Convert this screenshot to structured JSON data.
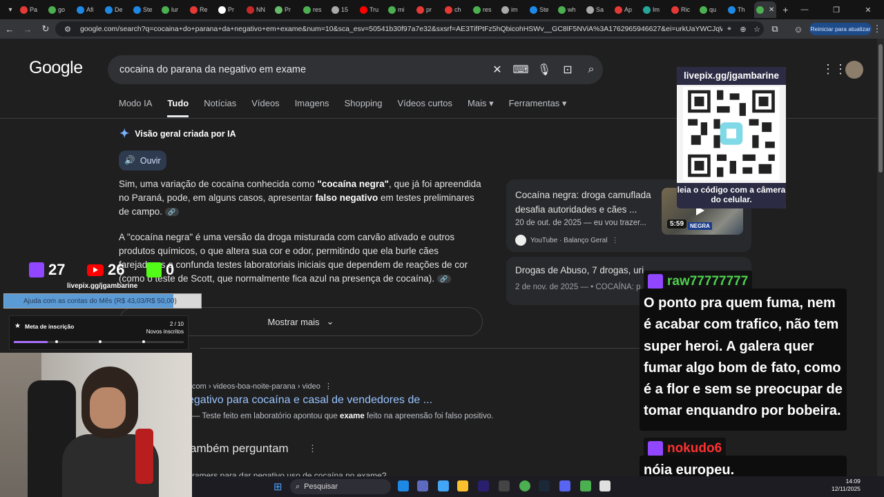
{
  "browser": {
    "tabs": [
      {
        "label": "Pa",
        "color": "#e53935"
      },
      {
        "label": "go",
        "color": "#4caf50"
      },
      {
        "label": "Afi",
        "color": "#1e88e5"
      },
      {
        "label": "De",
        "color": "#1e88e5"
      },
      {
        "label": "Ste",
        "color": "#1e88e5"
      },
      {
        "label": "lur",
        "color": "#4caf50"
      },
      {
        "label": "Re",
        "color": "#e53935"
      },
      {
        "label": "Pr",
        "color": "#ffffff"
      },
      {
        "label": "NN",
        "color": "#c62828"
      },
      {
        "label": "Pr",
        "color": "#66bb6a"
      },
      {
        "label": "res",
        "color": "#4caf50"
      },
      {
        "label": "15",
        "color": "#aaaaaa"
      },
      {
        "label": "Tru",
        "color": "#ff0000"
      },
      {
        "label": "mi",
        "color": "#4caf50"
      },
      {
        "label": "pr",
        "color": "#e53935"
      },
      {
        "label": "ch",
        "color": "#e53935"
      },
      {
        "label": "res",
        "color": "#4caf50"
      },
      {
        "label": "im",
        "color": "#aaaaaa"
      },
      {
        "label": "Ste",
        "color": "#1e88e5"
      },
      {
        "label": "wh",
        "color": "#4caf50"
      },
      {
        "label": "Sa",
        "color": "#aaaaaa"
      },
      {
        "label": "Ap",
        "color": "#e53935"
      },
      {
        "label": "Im",
        "color": "#26a69a"
      },
      {
        "label": "Ric",
        "color": "#e53935"
      },
      {
        "label": "qu",
        "color": "#4caf50"
      },
      {
        "label": "Th",
        "color": "#1e88e5"
      }
    ],
    "active_tab_color": "#4caf50",
    "url": "google.com/search?q=cocaina+do+parana+da+negativo+em+exame&num=10&sca_esv=50541b30f97a7e32&sxsrf=AE3TifPtFz5hQbicohHSWv__GC8lF5NViA%3A1762965946627&ei=urkUaYWCJqWChuMP_u7t2AU&oq=c...",
    "update_button": "Reiniciar para atualizar"
  },
  "search": {
    "logo": "Google",
    "query": "cocaina do parana da negativo em exame",
    "tabs": [
      "Modo IA",
      "Tudo",
      "Notícias",
      "Vídeos",
      "Imagens",
      "Shopping",
      "Vídeos curtos",
      "Mais",
      "Ferramentas"
    ]
  },
  "ai_overview": {
    "heading": "Visão geral criada por IA",
    "listen": "Ouvir",
    "show_more": "Mostrar mais"
  },
  "video_card": {
    "title": "Cocaína negra: droga camuflada desafia autoridades e cães ...",
    "date": "20 de out. de 2025 — eu vou trazer...",
    "source": "YouTube · Balanço Geral",
    "duration": "5:59",
    "thumb_label": "NEGRA"
  },
  "card2": {
    "title": "Drogas de Abuso, 7 drogas, uri...",
    "date": "2 de nov. de 2025 — • COCAÍNA: p..."
  },
  "result": {
    "cite": "com › videos-boa-noite-parana › video",
    "title": "egativo para cocaína e casal de vendedores de ...",
    "snippet_pre": "— Teste feito em laboratório apontou que ",
    "snippet_bold": "exame",
    "snippet_post": " feito na apreensão foi falso positivo.",
    "paa": "ambém perguntam",
    "paa_q": "ramers para dar negativo uso de cocaína no exame?"
  },
  "overlay": {
    "qr_url": "livepix.gg/jgambarine",
    "qr_caption": "leia o código com a câmera do celular.",
    "twitch_count": "27",
    "youtube_count": "26",
    "kick_count": "0",
    "livepix": "livepix.gg/jgambarine",
    "goal_text": "Ajuda com as contas do Mês (R$ 43,03/R$ 50,00)",
    "goal_progress": 0.86,
    "sub_title": "Meta de inscrição",
    "sub_count": "2 / 10",
    "sub_label": "Novos inscritos",
    "sub_progress": 0.2
  },
  "chat": [
    {
      "user": "raw77777777",
      "user_color": "#4fd14f",
      "message": "O ponto pra quem fuma, nem é acabar com trafico, não tem super heroi. A galera quer fumar algo bom de fato, como é a flor e sem se preocupar de tomar enquandro por bobeira."
    },
    {
      "user": "nokudo6",
      "user_color": "#ff3030",
      "message": "nóia europeu."
    }
  ],
  "taskbar": {
    "search": "Pesquisar",
    "time": "14:09",
    "date": "12/11/2025"
  }
}
